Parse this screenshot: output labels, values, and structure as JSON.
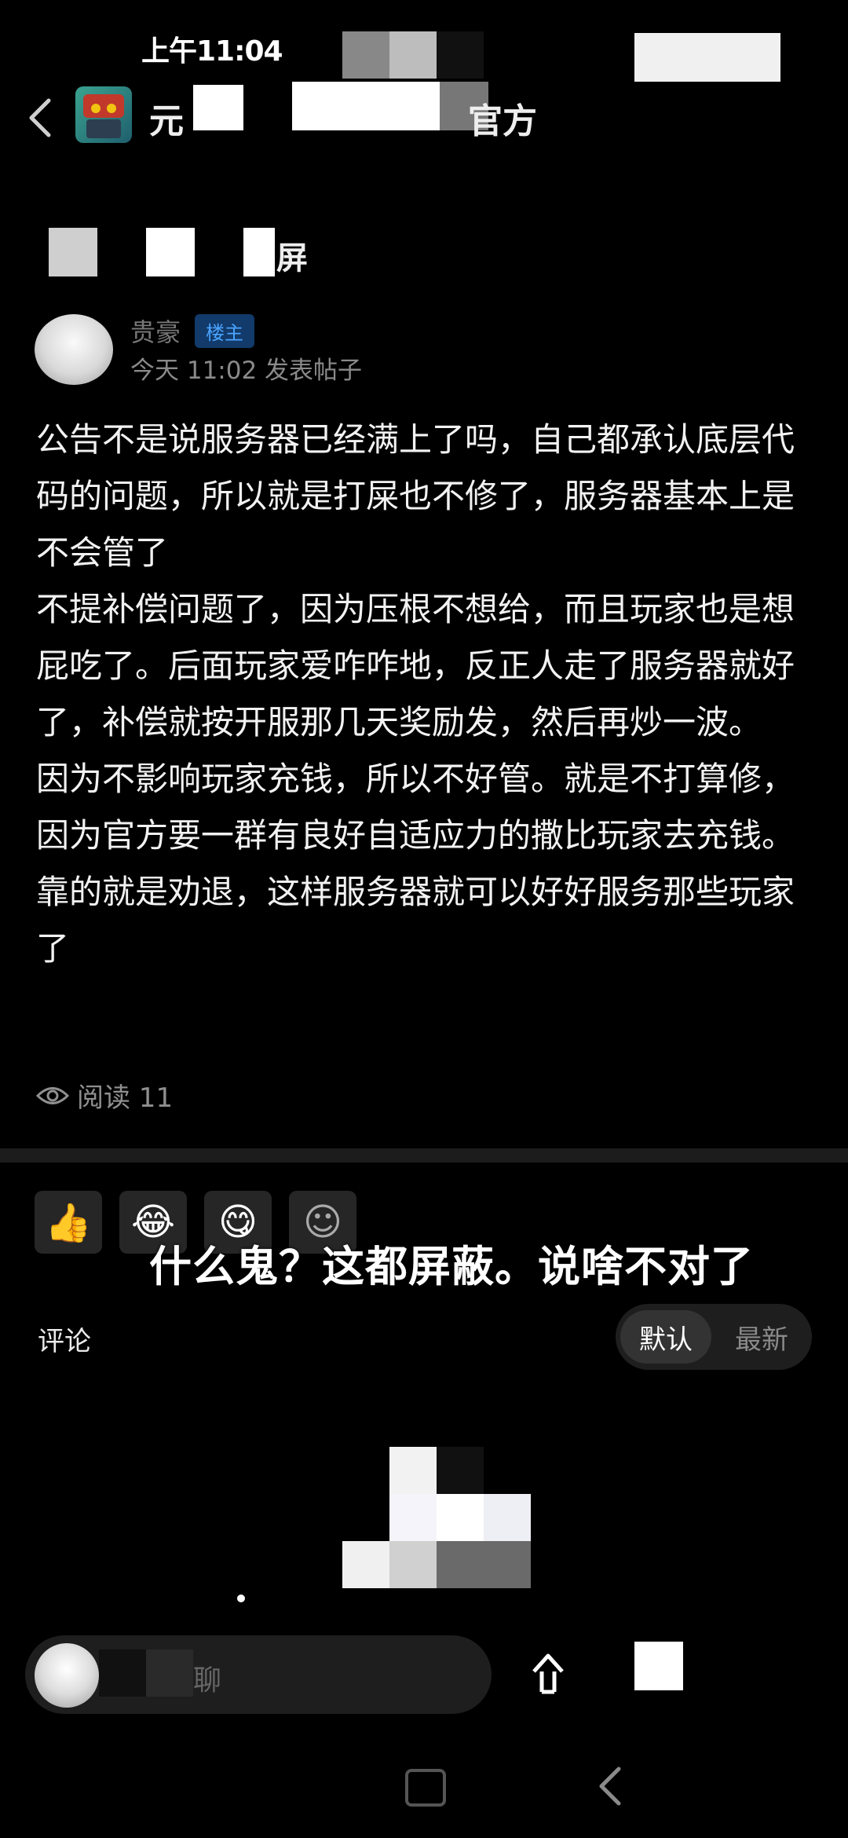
{
  "status_bar": {
    "time": "上午11:04"
  },
  "header": {
    "title_start": "元",
    "title_end": "官方"
  },
  "topic": {
    "title_end": "屏"
  },
  "post": {
    "author_badge": "楼主",
    "author_name": "贵豪",
    "meta": "今天 11:02 发表帖子",
    "paragraphs": [
      "公告不是说服务器已经满上了吗，自己都承认底层代码的问题，所以就是打屎也不修了，服务器基本上是不会管了",
      "不提补偿问题了，因为压根不想给，而且玩家也是想屁吃了。后面玩家爱咋咋地，反正人走了服务器就好了，补偿就按开服那几天奖励发，然后再炒一波。",
      "因为不影响玩家充钱，所以不好管。就是不打算修，因为官方要一群有良好自适应力的撒比玩家去充钱。靠的就是劝退，这样服务器就可以好好服务那些玩家了"
    ],
    "reads": "阅读 11"
  },
  "reactions": [
    {
      "icon": "thumbs-up-icon",
      "glyph": "👍"
    },
    {
      "icon": "laugh-cry-icon",
      "glyph": "😂"
    },
    {
      "icon": "yum-face-icon",
      "glyph": "😋"
    },
    {
      "icon": "add-emoji-icon",
      "glyph": "☺"
    }
  ],
  "overlay_caption": "什么鬼？这都屏蔽。说啥不对了",
  "comments": {
    "label": "评论",
    "sort_default": "默认",
    "sort_latest": "最新"
  },
  "input": {
    "placeholder": "聊"
  },
  "colors": {
    "background": "#000000",
    "badge_text": "#4aa3ff",
    "muted": "#8a8a8a"
  }
}
